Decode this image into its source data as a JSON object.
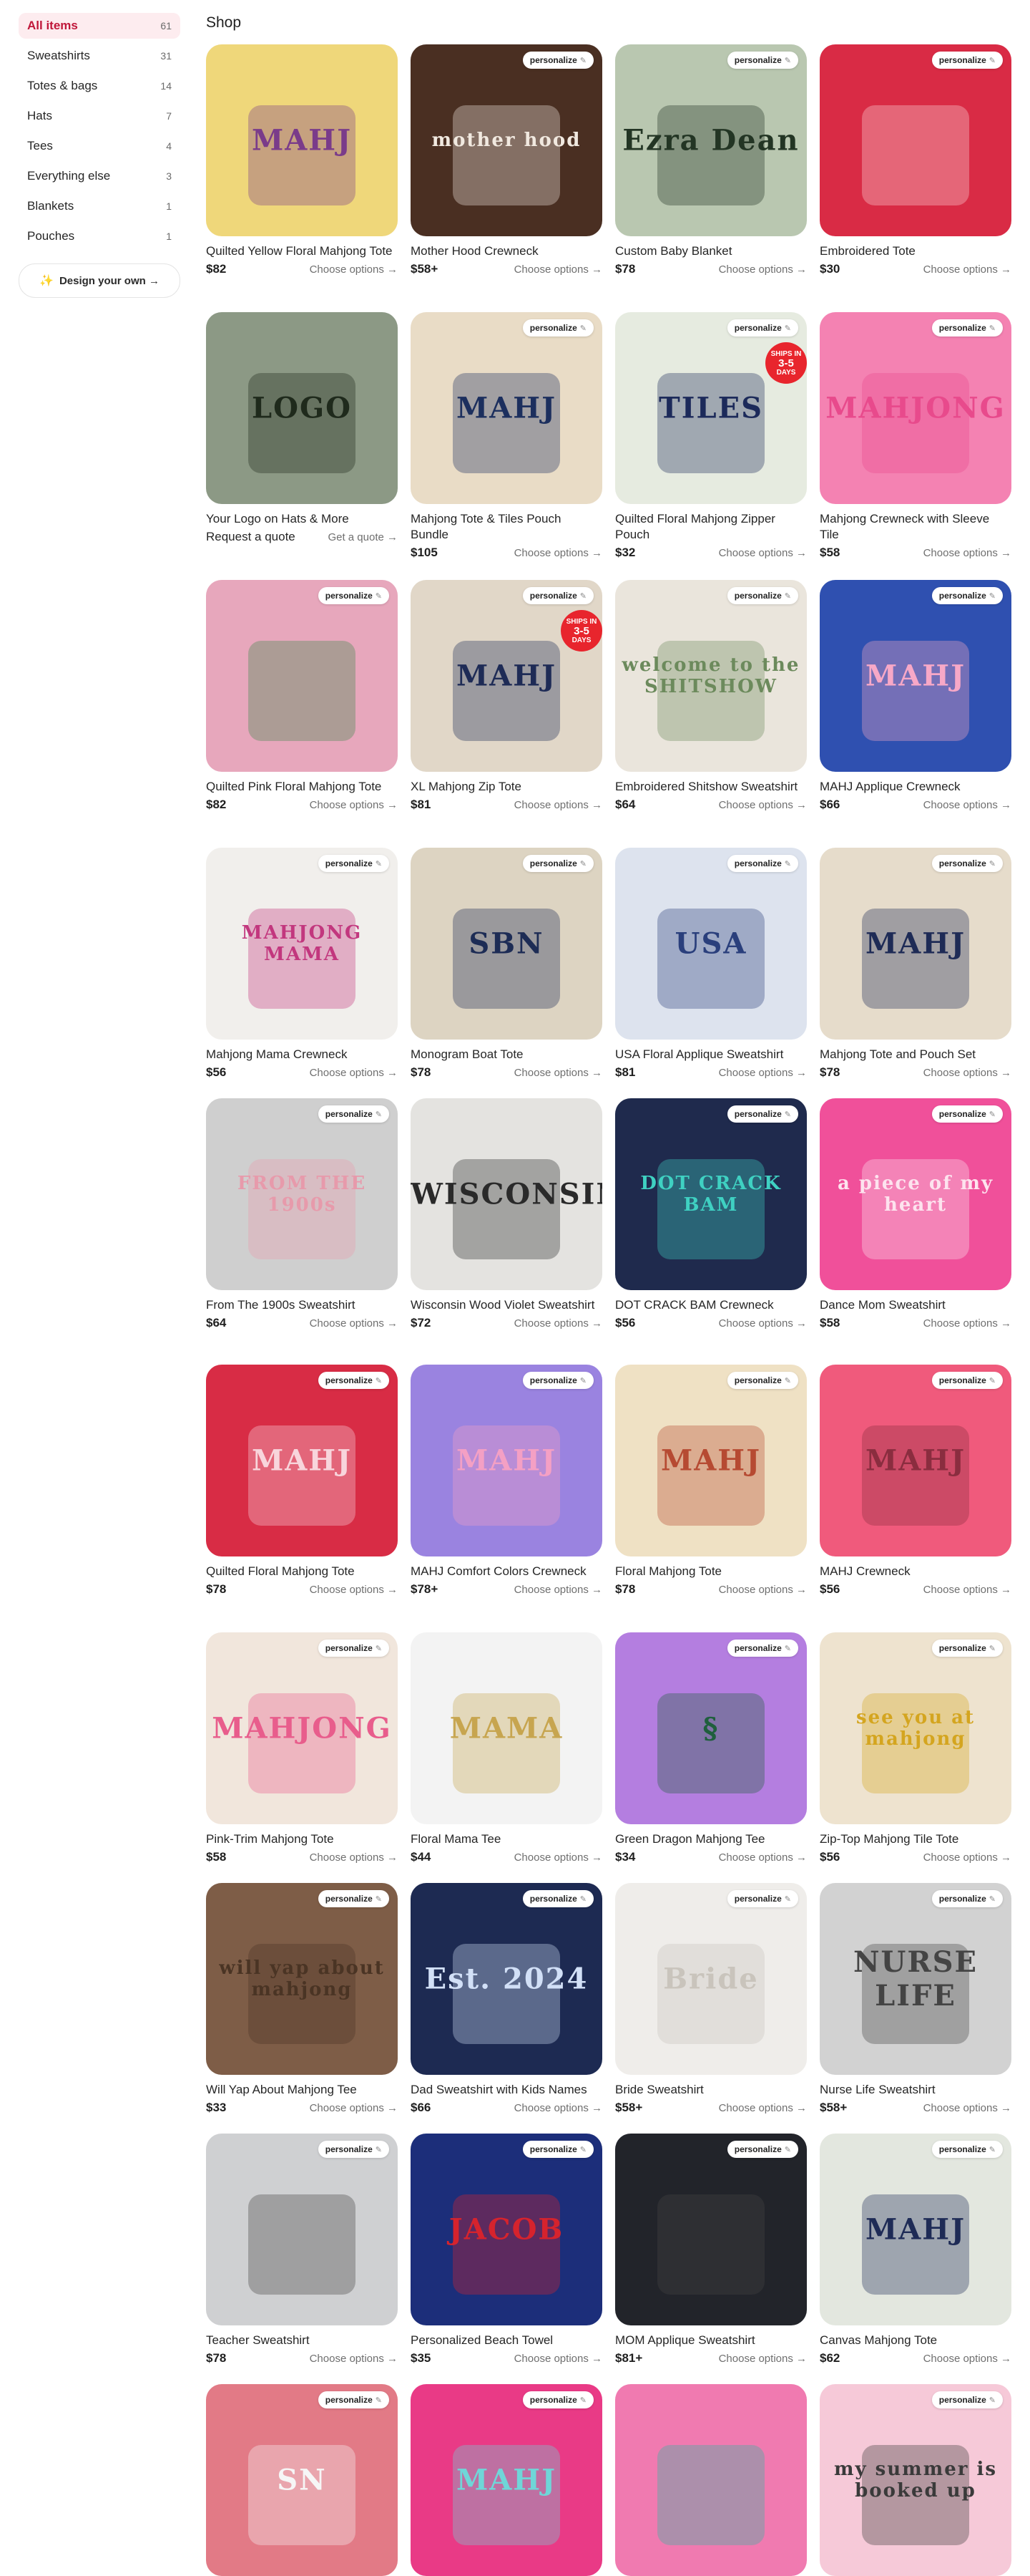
{
  "shop_title": "Shop",
  "personalize_label": "personalize",
  "choose_label": "Choose options →",
  "sidebar": {
    "items": [
      {
        "label": "All items",
        "count": "61"
      },
      {
        "label": "Sweatshirts",
        "count": "31"
      },
      {
        "label": "Totes & bags",
        "count": "14"
      },
      {
        "label": "Hats",
        "count": "7"
      },
      {
        "label": "Tees",
        "count": "4"
      },
      {
        "label": "Everything else",
        "count": "3"
      },
      {
        "label": "Blankets",
        "count": "1"
      },
      {
        "label": "Pouches",
        "count": "1"
      }
    ],
    "design_button": "Design your own →"
  },
  "products": [
    {
      "name": "Quilted Yellow Floral Mahjong Tote",
      "price": "$82",
      "action": "Choose options →",
      "personalize": false,
      "motif": "MAHJ",
      "bg": "#efd77a",
      "fg": "#7a3b8a"
    },
    {
      "name": "Mother Hood Crewneck",
      "price": "$58+",
      "action": "Choose options →",
      "personalize": true,
      "motif": "mother hood",
      "bg": "#4a2f22",
      "fg": "#f1e9e0"
    },
    {
      "name": "Custom Baby Blanket",
      "price": "$78",
      "action": "Choose options →",
      "personalize": true,
      "motif": "Ezra Dean",
      "bg": "#b9c7b0",
      "fg": "#233524"
    },
    {
      "name": "Embroidered Tote",
      "price": "$30",
      "action": "Choose options →",
      "personalize": true,
      "motif": "",
      "bg": "#d92b45",
      "fg": "#fbd3d8"
    },
    {
      "name": "Your Logo on Hats & More",
      "price": "",
      "action": "Get a quote →",
      "left_text": "Request a quote",
      "personalize": false,
      "motif": "LOGO",
      "bg": "#8c9985",
      "fg": "#1f2a1c"
    },
    {
      "name": "Mahjong Tote & Tiles Pouch Bundle",
      "price": "$105",
      "action": "Choose options →",
      "personalize": true,
      "motif": "MAHJ",
      "bg": "#e9dcc6",
      "fg": "#1c2f5e"
    },
    {
      "name": "Quilted Floral Mahjong Zipper Pouch",
      "price": "$32",
      "action": "Choose options →",
      "personalize": true,
      "motif": "TILES",
      "bg": "#e6ebe0",
      "fg": "#1c2a5a",
      "badge": {
        "top": "SHIPS IN",
        "big": "3-5",
        "bottom": "DAYS"
      }
    },
    {
      "name": "Mahjong Crewneck with Sleeve Tile",
      "price": "$58",
      "action": "Choose options →",
      "personalize": true,
      "motif": "MAHJONG",
      "bg": "#f482b2",
      "fg": "#e84a8c"
    },
    {
      "name": "Quilted Pink Floral Mahjong Tote",
      "price": "$82",
      "action": "Choose options →",
      "personalize": true,
      "motif": "",
      "bg": "#e7a7bc",
      "fg": "#3f8a4d"
    },
    {
      "name": "XL Mahjong Zip Tote",
      "price": "$81",
      "action": "Choose options →",
      "personalize": true,
      "motif": "MAHJ",
      "bg": "#e1d7c8",
      "fg": "#1e2b56",
      "badge": {
        "top": "SHIPS IN",
        "big": "3-5",
        "bottom": "DAYS"
      }
    },
    {
      "name": "Embroidered Shitshow Sweatshirt",
      "price": "$64",
      "action": "Choose options →",
      "personalize": true,
      "motif": "welcome to the SHITSHOW",
      "bg": "#eae5dc",
      "fg": "#6c8a5c"
    },
    {
      "name": "MAHJ Applique Crewneck",
      "price": "$66",
      "action": "Choose options →",
      "personalize": true,
      "motif": "MAHJ",
      "bg": "#2f50b0",
      "fg": "#f7a8c7"
    },
    {
      "name": "Mahjong Mama Crewneck",
      "price": "$56",
      "action": "Choose options →",
      "personalize": true,
      "motif": "MAHJONG MAMA",
      "bg": "#f1efec",
      "fg": "#c2377e"
    },
    {
      "name": "Monogram Boat Tote",
      "price": "$78",
      "action": "Choose options →",
      "personalize": true,
      "motif": "SBN",
      "bg": "#ddd4c2",
      "fg": "#1d2c55"
    },
    {
      "name": "USA Floral Applique Sweatshirt",
      "price": "$81",
      "action": "Choose options →",
      "personalize": true,
      "motif": "USA",
      "bg": "#dde3ee",
      "fg": "#2a3f7c"
    },
    {
      "name": "Mahjong Tote and Pouch Set",
      "price": "$78",
      "action": "Choose options →",
      "personalize": true,
      "motif": "MAHJ",
      "bg": "#e6dccb",
      "fg": "#1e2b56"
    },
    {
      "name": "From The 1900s Sweatshirt",
      "price": "$64",
      "action": "Choose options →",
      "personalize": true,
      "motif": "FROM THE 1900s",
      "bg": "#cfcfcf",
      "fg": "#e79aab"
    },
    {
      "name": "Wisconsin Wood Violet Sweatshirt",
      "price": "$72",
      "action": "Choose options →",
      "personalize": false,
      "motif": "WISCONSIN",
      "bg": "#e4e3e0",
      "fg": "#2a2a2a"
    },
    {
      "name": "DOT CRACK BAM Crewneck",
      "price": "$56",
      "action": "Choose options →",
      "personalize": true,
      "motif": "DOT CRACK BAM",
      "bg": "#1f2a4d",
      "fg": "#3fd1c2"
    },
    {
      "name": "Dance Mom Sweatshirt",
      "price": "$58",
      "action": "Choose options →",
      "personalize": true,
      "motif": "a piece of my heart",
      "bg": "#f0509a",
      "fg": "#fde3ee"
    },
    {
      "name": "Quilted Floral Mahjong Tote",
      "price": "$78",
      "action": "Choose options →",
      "personalize": true,
      "motif": "MAHJ",
      "bg": "#d82c45",
      "fg": "#f8d5dc"
    },
    {
      "name": "MAHJ Comfort Colors Crewneck",
      "price": "$78+",
      "action": "Choose options →",
      "personalize": true,
      "motif": "MAHJ",
      "bg": "#9a83e0",
      "fg": "#f4a0c4"
    },
    {
      "name": "Floral Mahjong Tote",
      "price": "$78",
      "action": "Choose options →",
      "personalize": true,
      "motif": "MAHJ",
      "bg": "#efe1c4",
      "fg": "#b64a32"
    },
    {
      "name": "MAHJ Crewneck",
      "price": "$56",
      "action": "Choose options →",
      "personalize": true,
      "motif": "MAHJ",
      "bg": "#f05a7c",
      "fg": "#8a2d3f"
    },
    {
      "name": "Pink-Trim Mahjong Tote",
      "price": "$58",
      "action": "Choose options →",
      "personalize": true,
      "motif": "MAHJONG",
      "bg": "#f1e6dc",
      "fg": "#e85d8c"
    },
    {
      "name": "Floral Mama Tee",
      "price": "$44",
      "action": "Choose options →",
      "personalize": false,
      "motif": "MAMA",
      "bg": "#f3f3f3",
      "fg": "#c7a54f"
    },
    {
      "name": "Green Dragon Mahjong Tee",
      "price": "$34",
      "action": "Choose options →",
      "personalize": true,
      "motif": "§",
      "bg": "#b47ee0",
      "fg": "#1f5f3d"
    },
    {
      "name": "Zip-Top Mahjong Tile Tote",
      "price": "$56",
      "action": "Choose options →",
      "personalize": true,
      "motif": "see you at mahjong",
      "bg": "#eee3cf",
      "fg": "#d4a51f"
    },
    {
      "name": "Will Yap About Mahjong Tee",
      "price": "$33",
      "action": "Choose options →",
      "personalize": true,
      "motif": "will yap about mahjong",
      "bg": "#7e5d47",
      "fg": "#4a3424"
    },
    {
      "name": "Dad Sweatshirt with Kids Names",
      "price": "$66",
      "action": "Choose options →",
      "personalize": true,
      "motif": "Est. 2024",
      "bg": "#1d2a52",
      "fg": "#d2e0f7"
    },
    {
      "name": "Bride Sweatshirt",
      "price": "$58+",
      "action": "Choose options →",
      "personalize": true,
      "motif": "Bride",
      "bg": "#efedea",
      "fg": "#c9c4bc"
    },
    {
      "name": "Nurse Life Sweatshirt",
      "price": "$58+",
      "action": "Choose options →",
      "personalize": true,
      "motif": "NURSE LIFE",
      "bg": "#d2d2d2",
      "fg": "#444"
    },
    {
      "name": "Teacher Sweatshirt",
      "price": "$78",
      "action": "Choose options →",
      "personalize": true,
      "motif": "",
      "bg": "#cfd0d2",
      "fg": "#444"
    },
    {
      "name": "Personalized Beach Towel",
      "price": "$35",
      "action": "Choose options →",
      "personalize": true,
      "motif": "JACOB",
      "bg": "#1c2e7a",
      "fg": "#d6232d"
    },
    {
      "name": "MOM Applique Sweatshirt",
      "price": "$81+",
      "action": "Choose options →",
      "personalize": true,
      "motif": "",
      "bg": "#22242a",
      "fg": "#444"
    },
    {
      "name": "Canvas Mahjong Tote",
      "price": "$62",
      "action": "Choose options →",
      "personalize": true,
      "motif": "MAHJ",
      "bg": "#e3e7df",
      "fg": "#1e2b56"
    },
    {
      "name": "",
      "price": "",
      "action": "",
      "personalize": true,
      "motif": "SN",
      "bg": "#e27a86",
      "fg": "#f6f6f6"
    },
    {
      "name": "",
      "price": "",
      "action": "",
      "personalize": true,
      "motif": "MAHJ",
      "bg": "#e93a86",
      "fg": "#6fd6d8"
    },
    {
      "name": "",
      "price": "",
      "action": "",
      "personalize": false,
      "motif": "",
      "bg": "#f07ab0",
      "fg": "#2db6a4"
    },
    {
      "name": "",
      "price": "",
      "action": "",
      "personalize": true,
      "motif": "my summer is booked up",
      "bg": "#f6c9d8",
      "fg": "#3a3a3a"
    }
  ]
}
